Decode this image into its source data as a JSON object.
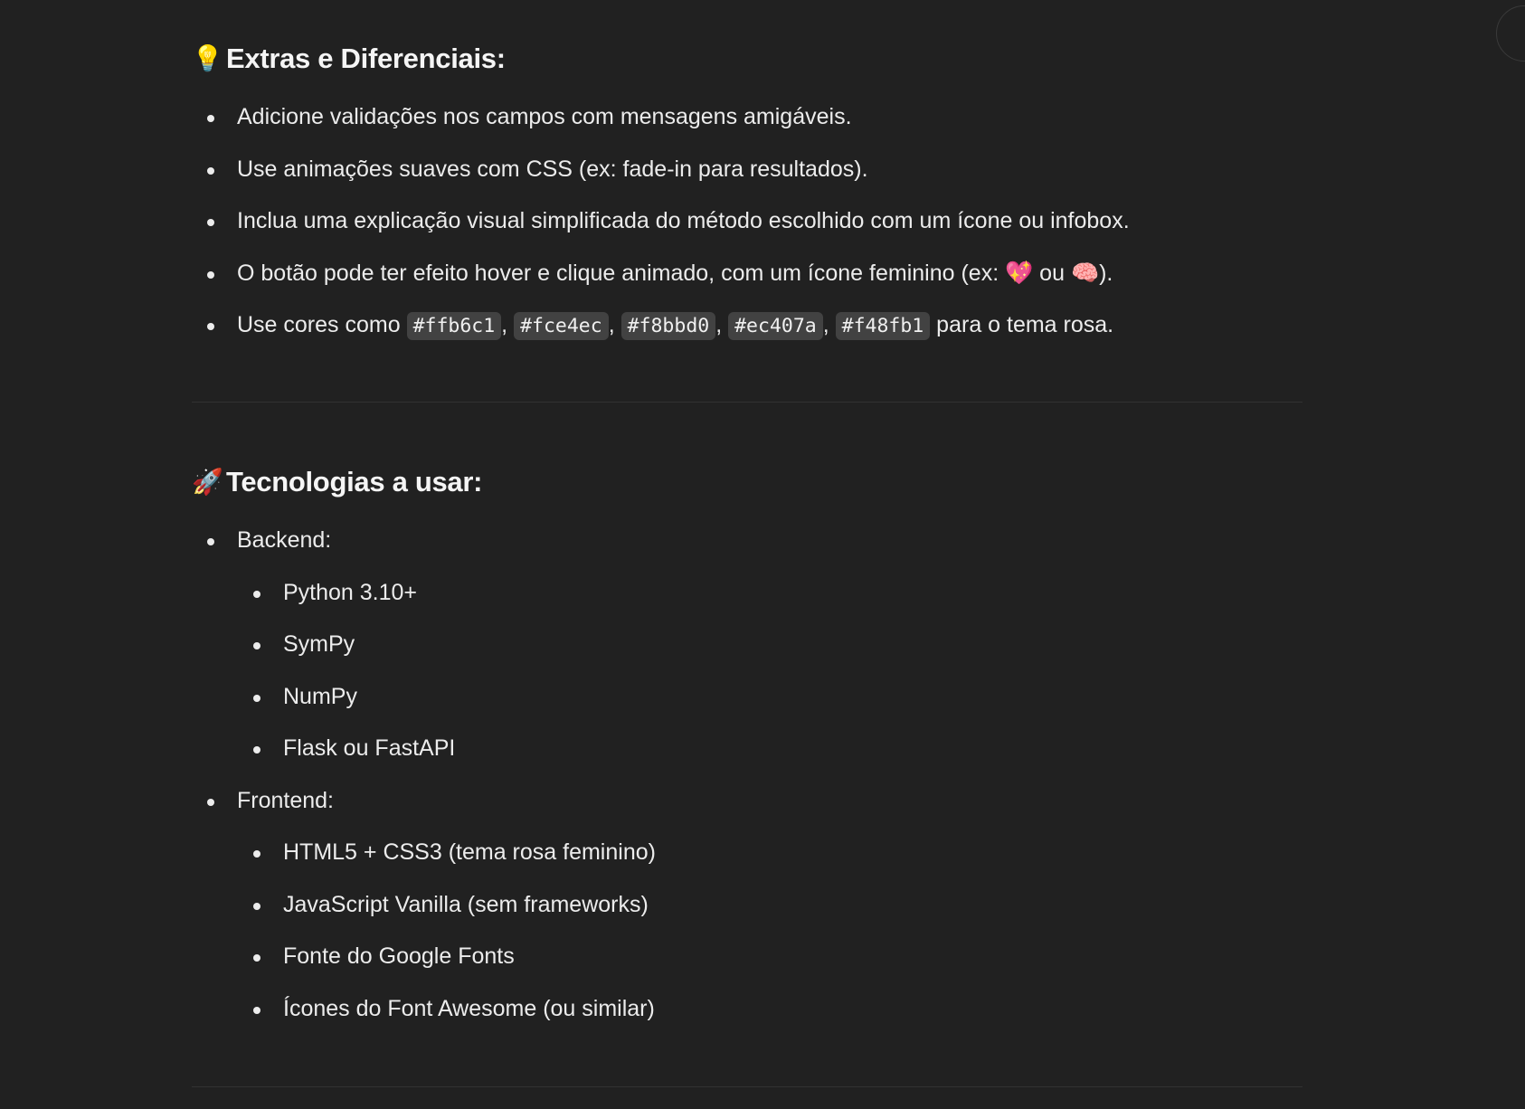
{
  "extras": {
    "emoji": "💡",
    "title": "Extras e Diferenciais:",
    "items": [
      "Adicione validações nos campos com mensagens amigáveis.",
      "Use animações suaves com CSS (ex: fade-in para resultados).",
      "Inclua uma explicação visual simplificada do método escolhido com um ícone ou infobox."
    ],
    "hover_item": {
      "text_before": "O botão pode ter efeito hover e clique animado, com um ícone feminino (ex: ",
      "emoji_1": "💖",
      "text_mid": " ou ",
      "emoji_2": "🧠",
      "text_after": ")."
    },
    "colors_item": {
      "prefix": "Use cores como ",
      "codes": [
        "#ffb6c1",
        "#fce4ec",
        "#f8bbd0",
        "#ec407a",
        "#f48fb1"
      ],
      "sep": ", ",
      "suffix": " para o tema rosa."
    }
  },
  "tech": {
    "emoji": "🚀",
    "title": "Tecnologias a usar:",
    "backend_label": "Backend:",
    "backend_items": [
      "Python 3.10+",
      "SymPy",
      "NumPy",
      "Flask ou FastAPI"
    ],
    "frontend_label": "Frontend:",
    "frontend_items": [
      "HTML5 + CSS3 (tema rosa feminino)",
      "JavaScript Vanilla (sem frameworks)",
      "Fonte do Google Fonts",
      "Ícones do Font Awesome (ou similar)"
    ]
  }
}
